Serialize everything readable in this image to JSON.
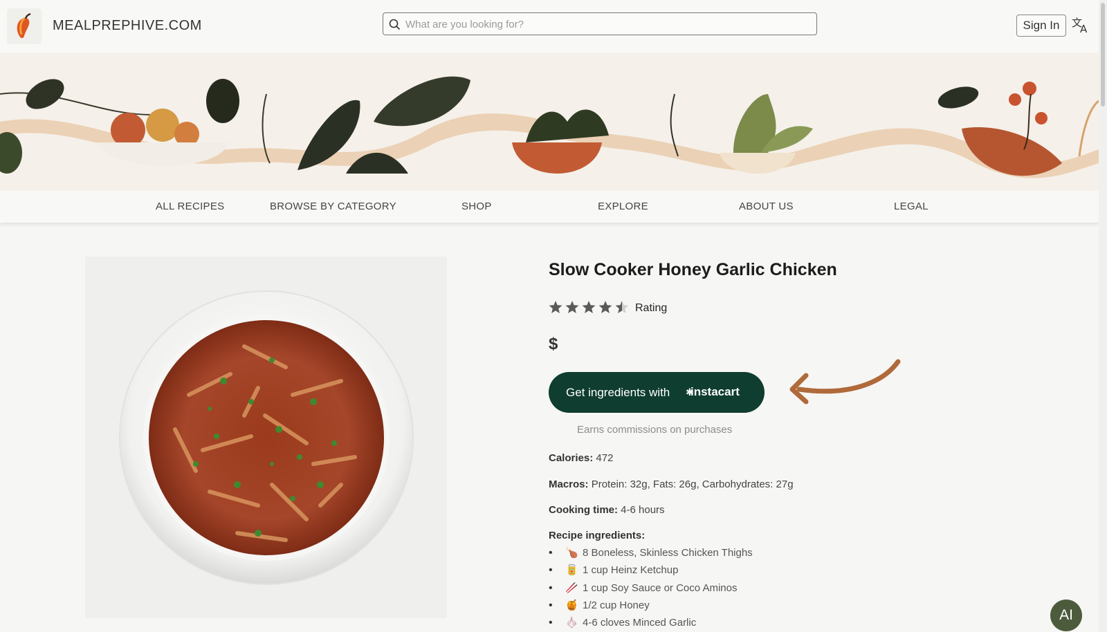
{
  "header": {
    "site_name": "MEALPREPHIVE.COM",
    "search_placeholder": "What are you looking for?",
    "sign_in_label": "Sign In"
  },
  "nav": {
    "items": [
      "ALL RECIPES",
      "BROWSE BY CATEGORY",
      "SHOP",
      "EXPLORE",
      "ABOUT US",
      "LEGAL"
    ]
  },
  "recipe": {
    "title": "Slow Cooker Honey Garlic Chicken",
    "rating_label": "Rating",
    "rating_stars": 4.5,
    "price": "$",
    "cta_prefix": "Get ingredients with",
    "cta_brand": "instacart",
    "commission_note": "Earns commissions on purchases",
    "calories_label": "Calories:",
    "calories_value": "472",
    "macros_label": "Macros:",
    "macros_value": "Protein: 32g, Fats: 26g, Carbohydrates: 27g",
    "cooking_time_label": "Cooking time:",
    "cooking_time_value": "4-6 hours",
    "ingredients_label": "Recipe ingredients:",
    "ingredients": [
      {
        "emoji": "🍗",
        "text": "8 Boneless, Skinless Chicken Thighs"
      },
      {
        "emoji": "🥫",
        "text": "1 cup Heinz Ketchup"
      },
      {
        "emoji": "🥢",
        "text": "1 cup Soy Sauce or Coco Aminos"
      },
      {
        "emoji": "🍯",
        "text": "1/2 cup Honey"
      },
      {
        "emoji": "🧄",
        "text": "4-6 cloves Minced Garlic"
      }
    ]
  },
  "ai_button_label": "AI",
  "colors": {
    "cta_background": "#0f3d2f",
    "arrow": "#b06a3a",
    "ai_button": "#4c5b3c"
  }
}
